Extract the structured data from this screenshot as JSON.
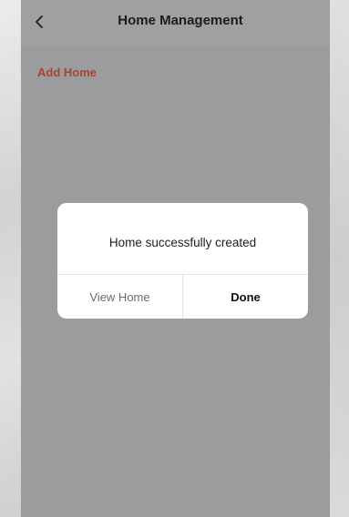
{
  "header": {
    "title": "Home Management",
    "back_icon": "chevron-left-icon"
  },
  "main": {
    "add_home_label": "Add Home",
    "accent_color": "#b0402e"
  },
  "dialog": {
    "message": "Home successfully created",
    "view_home_label": "View Home",
    "done_label": "Done"
  }
}
